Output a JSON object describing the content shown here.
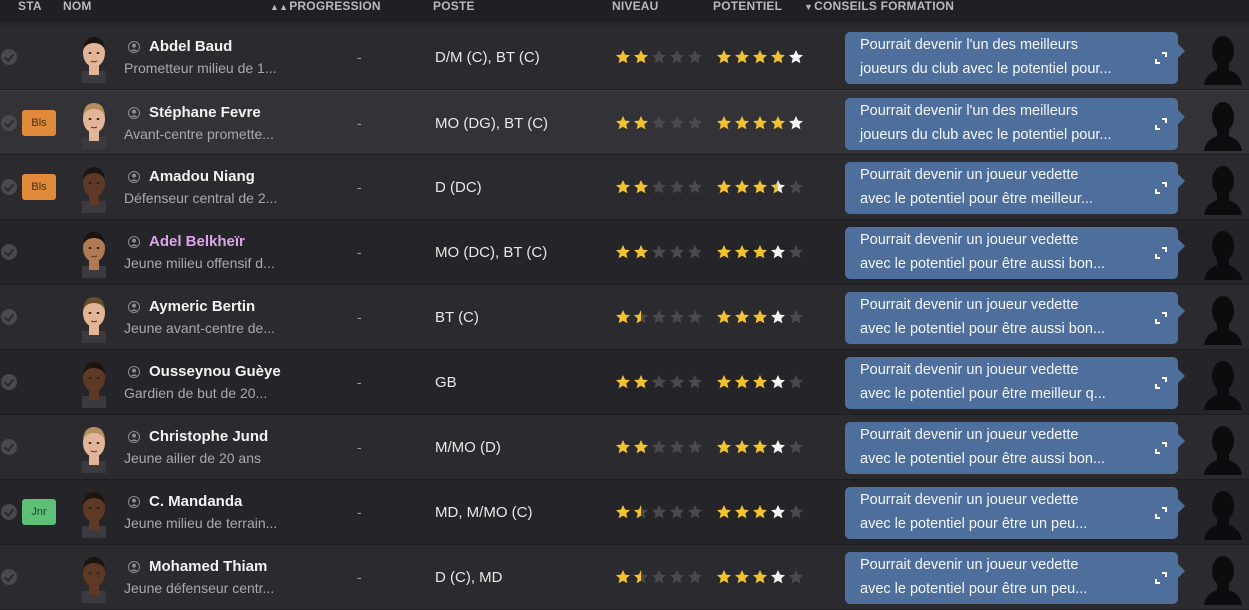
{
  "columns": {
    "sta": "STA",
    "nom": "NOM",
    "progression": "PROGRESSION",
    "poste": "POSTE",
    "niveau": "NIVEAU",
    "potentiel": "POTENTIEL",
    "conseils": "CONSEILS FORMATION"
  },
  "icons": {
    "check": "check-circle-icon",
    "person": "person-icon",
    "expand": "expand-icon",
    "star": "star-icon",
    "coach": "coach-silhouette-icon",
    "sort_asc": "sort-ascending-icon",
    "sort_desc": "sort-descending-icon"
  },
  "colors": {
    "star_gold": "#f2c230",
    "star_white": "#f4f4f4",
    "star_empty": "#4a4a4e",
    "advice_bg": "#4e6f9c",
    "badge_bls": "#e08a3a",
    "badge_jnr": "#5dbf78",
    "name_purple": "#d9a5e8"
  },
  "players": [
    {
      "name": "Abdel Baud",
      "desc": "Prometteur milieu de 1...",
      "badge": "",
      "progression": "-",
      "poste": "D/M (C), BT (C)",
      "niveau": 2,
      "niveau_max": 5,
      "potentiel_gold": 4,
      "potentiel_white": 1,
      "advice_l1": "Pourrait devenir l'un des meilleurs",
      "advice_l2": "joueurs du club avec le potentiel pour...",
      "skin": "light",
      "hair": "dark"
    },
    {
      "name": "Stéphane Fevre",
      "desc": "Avant-centre promette...",
      "badge": "Bls",
      "progression": "-",
      "poste": "MO (DG), BT (C)",
      "niveau": 2,
      "niveau_max": 5,
      "potentiel_gold": 4,
      "potentiel_white": 1,
      "advice_l1": "Pourrait devenir l'un des meilleurs",
      "advice_l2": "joueurs du club avec le potentiel pour...",
      "skin": "light",
      "hair": "light"
    },
    {
      "name": "Amadou Niang",
      "desc": "Défenseur central de 2...",
      "badge": "Bls",
      "progression": "-",
      "poste": "D (DC)",
      "niveau": 2,
      "niveau_max": 5,
      "potentiel_gold": 3.5,
      "potentiel_white": 1,
      "advice_l1": "Pourrait devenir un joueur vedette",
      "advice_l2": "avec le potentiel pour être meilleur...",
      "skin": "dark",
      "hair": "dark"
    },
    {
      "name": "Adel Belkheïr",
      "desc": "Jeune milieu offensif d...",
      "badge": "",
      "purple": true,
      "progression": "-",
      "poste": "MO (DC), BT (C)",
      "niveau": 2,
      "niveau_max": 5,
      "potentiel_gold": 3,
      "potentiel_white": 1,
      "advice_l1": "Pourrait devenir un joueur vedette",
      "advice_l2": "avec le potentiel pour être aussi bon...",
      "skin": "medium",
      "hair": "dark"
    },
    {
      "name": "Aymeric Bertin",
      "desc": "Jeune avant-centre de...",
      "badge": "",
      "progression": "-",
      "poste": "BT (C)",
      "niveau": 1.5,
      "niveau_max": 5,
      "potentiel_gold": 3,
      "potentiel_white": 1,
      "advice_l1": "Pourrait devenir un joueur vedette",
      "advice_l2": "avec le potentiel pour être aussi bon...",
      "skin": "light",
      "hair": "brown"
    },
    {
      "name": "Ousseynou Guèye",
      "desc": "Gardien de but de 20...",
      "badge": "",
      "progression": "-",
      "poste": "GB",
      "niveau": 2,
      "niveau_max": 5,
      "potentiel_gold": 3,
      "potentiel_white": 1,
      "advice_l1": "Pourrait devenir un joueur vedette",
      "advice_l2": "avec le potentiel pour être meilleur q...",
      "skin": "dark",
      "hair": "dark"
    },
    {
      "name": "Christophe Jund",
      "desc": "Jeune ailier de 20 ans",
      "badge": "",
      "progression": "-",
      "poste": "M/MO (D)",
      "niveau": 2,
      "niveau_max": 5,
      "potentiel_gold": 3,
      "potentiel_white": 1,
      "advice_l1": "Pourrait devenir un joueur vedette",
      "advice_l2": "avec le potentiel pour être aussi bon...",
      "skin": "light",
      "hair": "light"
    },
    {
      "name": "C. Mandanda",
      "desc": "Jeune milieu de terrain...",
      "badge": "Jnr",
      "progression": "-",
      "poste": "MD, M/MO (C)",
      "niveau": 1.5,
      "niveau_max": 5,
      "potentiel_gold": 3,
      "potentiel_white": 1,
      "advice_l1": "Pourrait devenir un joueur vedette",
      "advice_l2": "avec le potentiel pour être un peu...",
      "skin": "dark",
      "hair": "dark"
    },
    {
      "name": "Mohamed Thiam",
      "desc": "Jeune défenseur centr...",
      "badge": "",
      "progression": "-",
      "poste": "D (C), MD",
      "niveau": 1.5,
      "niveau_max": 5,
      "potentiel_gold": 3,
      "potentiel_white": 1,
      "advice_l1": "Pourrait devenir un joueur vedette",
      "advice_l2": "avec le potentiel pour être un peu...",
      "skin": "dark",
      "hair": "dark"
    }
  ]
}
